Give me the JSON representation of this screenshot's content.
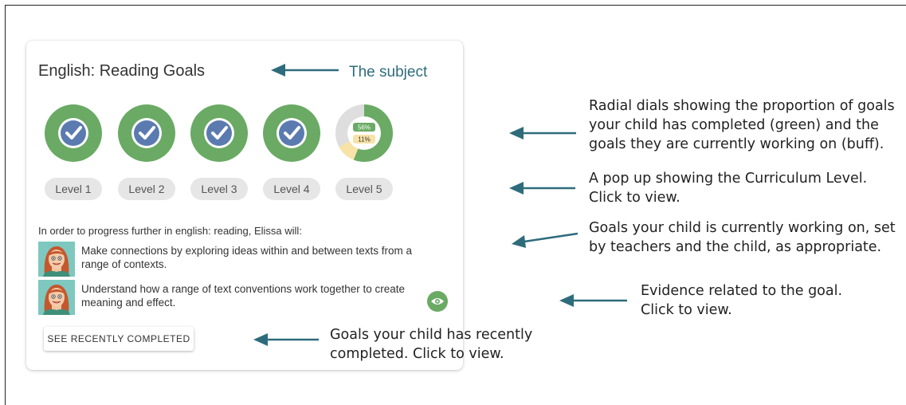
{
  "card": {
    "title": "English: Reading Goals",
    "dials": [
      {
        "level": "Level 1",
        "status": "complete"
      },
      {
        "level": "Level 2",
        "status": "complete"
      },
      {
        "level": "Level 3",
        "status": "complete"
      },
      {
        "level": "Level 4",
        "status": "complete"
      },
      {
        "level": "Level 5",
        "status": "partial",
        "completed_label": "56%",
        "in_progress_label": "11%",
        "completed_fraction": 0.56,
        "in_progress_fraction": 0.11
      }
    ],
    "intro": "In order to progress further in english: reading, Elissa will:",
    "goals": [
      {
        "text": "Make connections by exploring ideas within and between texts from a range of contexts.",
        "has_evidence": false
      },
      {
        "text": "Understand how a range of text conventions work together to create meaning and effect.",
        "has_evidence": true
      }
    ],
    "recent_button": "SEE RECENTLY COMPLETED"
  },
  "annotations": {
    "subject": "The subject",
    "dials_line1": "Radial dials showing the proportion of goals",
    "dials_line2": "your child has completed (green) and the",
    "dials_line3": "goals they are currently working on (buff).",
    "popup_line1": "A pop up showing the Curriculum Level.",
    "popup_line2": "Click to view.",
    "goals_line1": "Goals your child is currently working on, set",
    "goals_line2": "by teachers and the child, as appropriate.",
    "evidence_line1": "Evidence related to the goal.",
    "evidence_line2": "Click to view.",
    "recent_line1": "Goals your child has recently",
    "recent_line2": "completed. Click to view."
  },
  "colors": {
    "dial_green": "#6aaa64",
    "check_blue": "#5b7bb0",
    "buff": "#f7e3a8",
    "remaining_grey": "#dedede",
    "arrow_teal": "#2e6c7c",
    "subject_teal": "#2e6c7c"
  },
  "icons": {
    "check": "check-icon",
    "eye": "eye-icon",
    "avatar": "avatar-icon"
  }
}
